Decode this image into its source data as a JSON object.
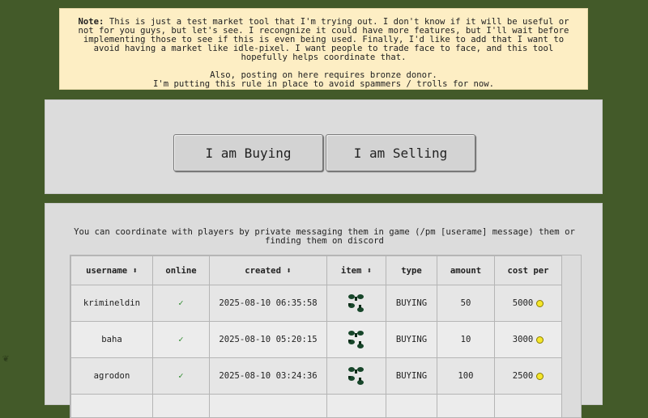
{
  "note": {
    "label": "Note:",
    "text": "This is just a test market tool that I'm trying out. I don't know if it will be useful or not for you guys, but let's see. I recongnize it could have more features, but I'll wait before implementing those to see if this is even being used. Finally, I'd like to add that I want to avoid having a market like idle-pixel. I want people to trade face to face, and this tool hopefully helps coordinate that.",
    "line2": "Also, posting on here requires bronze donor.",
    "line3": "I'm putting this rule in place to avoid spammers / trolls for now."
  },
  "buttons": {
    "buy_label": "I am Buying",
    "sell_label": "I am Selling"
  },
  "market": {
    "description": "You can coordinate with players by private messaging them in game (/pm [userame] message) them or finding them on discord",
    "columns": [
      "username ⬍",
      "online",
      "created ⬍",
      "item ⬍",
      "type",
      "amount",
      "cost per"
    ],
    "rows": [
      {
        "username": "krimineldin",
        "online": "✓",
        "created": "2025-08-10 06:35:58",
        "item_icon": "clover-icon",
        "type": "BUYING",
        "amount": "50",
        "cost": "5000"
      },
      {
        "username": "baha",
        "online": "✓",
        "created": "2025-08-10 05:20:15",
        "item_icon": "clover-icon",
        "type": "BUYING",
        "amount": "10",
        "cost": "3000"
      },
      {
        "username": "agrodon",
        "online": "✓",
        "created": "2025-08-10 03:24:36",
        "item_icon": "clover-icon",
        "type": "BUYING",
        "amount": "100",
        "cost": "2500"
      }
    ]
  },
  "colors": {
    "background": "#435a29",
    "note_bg": "#fdeec4",
    "panel_bg": "#dcdcdc",
    "coin": "#f5e62a",
    "check": "#2e8b2e"
  }
}
